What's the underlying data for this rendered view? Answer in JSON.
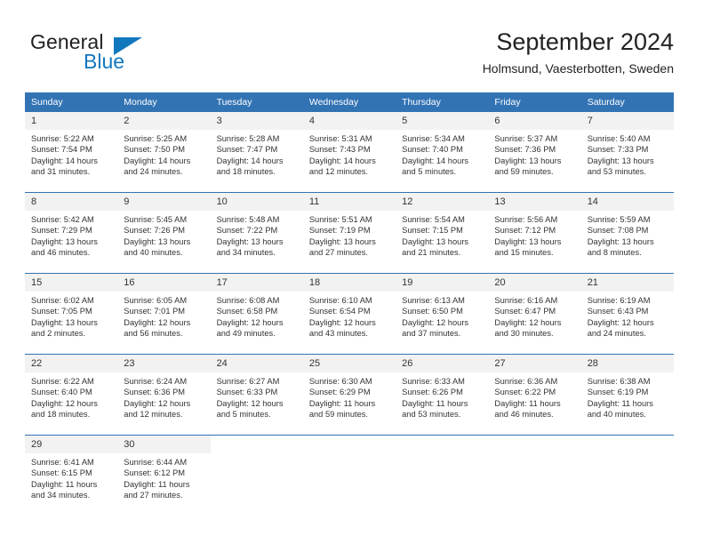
{
  "brand": {
    "name_part1": "General",
    "name_part2": "Blue",
    "accent_color": "#1278bd"
  },
  "header": {
    "title": "September 2024",
    "subtitle": "Holmsund, Vaesterbotten, Sweden"
  },
  "theme": {
    "header_blue": "#3273b4",
    "daynum_band": "#f2f2f2",
    "text": "#333333"
  },
  "calendar": {
    "weekday_headers": [
      "Sunday",
      "Monday",
      "Tuesday",
      "Wednesday",
      "Thursday",
      "Friday",
      "Saturday"
    ],
    "weeks": [
      [
        {
          "day": "1",
          "sunrise": "Sunrise: 5:22 AM",
          "sunset": "Sunset: 7:54 PM",
          "daylight_line1": "Daylight: 14 hours",
          "daylight_line2": "and 31 minutes."
        },
        {
          "day": "2",
          "sunrise": "Sunrise: 5:25 AM",
          "sunset": "Sunset: 7:50 PM",
          "daylight_line1": "Daylight: 14 hours",
          "daylight_line2": "and 24 minutes."
        },
        {
          "day": "3",
          "sunrise": "Sunrise: 5:28 AM",
          "sunset": "Sunset: 7:47 PM",
          "daylight_line1": "Daylight: 14 hours",
          "daylight_line2": "and 18 minutes."
        },
        {
          "day": "4",
          "sunrise": "Sunrise: 5:31 AM",
          "sunset": "Sunset: 7:43 PM",
          "daylight_line1": "Daylight: 14 hours",
          "daylight_line2": "and 12 minutes."
        },
        {
          "day": "5",
          "sunrise": "Sunrise: 5:34 AM",
          "sunset": "Sunset: 7:40 PM",
          "daylight_line1": "Daylight: 14 hours",
          "daylight_line2": "and 5 minutes."
        },
        {
          "day": "6",
          "sunrise": "Sunrise: 5:37 AM",
          "sunset": "Sunset: 7:36 PM",
          "daylight_line1": "Daylight: 13 hours",
          "daylight_line2": "and 59 minutes."
        },
        {
          "day": "7",
          "sunrise": "Sunrise: 5:40 AM",
          "sunset": "Sunset: 7:33 PM",
          "daylight_line1": "Daylight: 13 hours",
          "daylight_line2": "and 53 minutes."
        }
      ],
      [
        {
          "day": "8",
          "sunrise": "Sunrise: 5:42 AM",
          "sunset": "Sunset: 7:29 PM",
          "daylight_line1": "Daylight: 13 hours",
          "daylight_line2": "and 46 minutes."
        },
        {
          "day": "9",
          "sunrise": "Sunrise: 5:45 AM",
          "sunset": "Sunset: 7:26 PM",
          "daylight_line1": "Daylight: 13 hours",
          "daylight_line2": "and 40 minutes."
        },
        {
          "day": "10",
          "sunrise": "Sunrise: 5:48 AM",
          "sunset": "Sunset: 7:22 PM",
          "daylight_line1": "Daylight: 13 hours",
          "daylight_line2": "and 34 minutes."
        },
        {
          "day": "11",
          "sunrise": "Sunrise: 5:51 AM",
          "sunset": "Sunset: 7:19 PM",
          "daylight_line1": "Daylight: 13 hours",
          "daylight_line2": "and 27 minutes."
        },
        {
          "day": "12",
          "sunrise": "Sunrise: 5:54 AM",
          "sunset": "Sunset: 7:15 PM",
          "daylight_line1": "Daylight: 13 hours",
          "daylight_line2": "and 21 minutes."
        },
        {
          "day": "13",
          "sunrise": "Sunrise: 5:56 AM",
          "sunset": "Sunset: 7:12 PM",
          "daylight_line1": "Daylight: 13 hours",
          "daylight_line2": "and 15 minutes."
        },
        {
          "day": "14",
          "sunrise": "Sunrise: 5:59 AM",
          "sunset": "Sunset: 7:08 PM",
          "daylight_line1": "Daylight: 13 hours",
          "daylight_line2": "and 8 minutes."
        }
      ],
      [
        {
          "day": "15",
          "sunrise": "Sunrise: 6:02 AM",
          "sunset": "Sunset: 7:05 PM",
          "daylight_line1": "Daylight: 13 hours",
          "daylight_line2": "and 2 minutes."
        },
        {
          "day": "16",
          "sunrise": "Sunrise: 6:05 AM",
          "sunset": "Sunset: 7:01 PM",
          "daylight_line1": "Daylight: 12 hours",
          "daylight_line2": "and 56 minutes."
        },
        {
          "day": "17",
          "sunrise": "Sunrise: 6:08 AM",
          "sunset": "Sunset: 6:58 PM",
          "daylight_line1": "Daylight: 12 hours",
          "daylight_line2": "and 49 minutes."
        },
        {
          "day": "18",
          "sunrise": "Sunrise: 6:10 AM",
          "sunset": "Sunset: 6:54 PM",
          "daylight_line1": "Daylight: 12 hours",
          "daylight_line2": "and 43 minutes."
        },
        {
          "day": "19",
          "sunrise": "Sunrise: 6:13 AM",
          "sunset": "Sunset: 6:50 PM",
          "daylight_line1": "Daylight: 12 hours",
          "daylight_line2": "and 37 minutes."
        },
        {
          "day": "20",
          "sunrise": "Sunrise: 6:16 AM",
          "sunset": "Sunset: 6:47 PM",
          "daylight_line1": "Daylight: 12 hours",
          "daylight_line2": "and 30 minutes."
        },
        {
          "day": "21",
          "sunrise": "Sunrise: 6:19 AM",
          "sunset": "Sunset: 6:43 PM",
          "daylight_line1": "Daylight: 12 hours",
          "daylight_line2": "and 24 minutes."
        }
      ],
      [
        {
          "day": "22",
          "sunrise": "Sunrise: 6:22 AM",
          "sunset": "Sunset: 6:40 PM",
          "daylight_line1": "Daylight: 12 hours",
          "daylight_line2": "and 18 minutes."
        },
        {
          "day": "23",
          "sunrise": "Sunrise: 6:24 AM",
          "sunset": "Sunset: 6:36 PM",
          "daylight_line1": "Daylight: 12 hours",
          "daylight_line2": "and 12 minutes."
        },
        {
          "day": "24",
          "sunrise": "Sunrise: 6:27 AM",
          "sunset": "Sunset: 6:33 PM",
          "daylight_line1": "Daylight: 12 hours",
          "daylight_line2": "and 5 minutes."
        },
        {
          "day": "25",
          "sunrise": "Sunrise: 6:30 AM",
          "sunset": "Sunset: 6:29 PM",
          "daylight_line1": "Daylight: 11 hours",
          "daylight_line2": "and 59 minutes."
        },
        {
          "day": "26",
          "sunrise": "Sunrise: 6:33 AM",
          "sunset": "Sunset: 6:26 PM",
          "daylight_line1": "Daylight: 11 hours",
          "daylight_line2": "and 53 minutes."
        },
        {
          "day": "27",
          "sunrise": "Sunrise: 6:36 AM",
          "sunset": "Sunset: 6:22 PM",
          "daylight_line1": "Daylight: 11 hours",
          "daylight_line2": "and 46 minutes."
        },
        {
          "day": "28",
          "sunrise": "Sunrise: 6:38 AM",
          "sunset": "Sunset: 6:19 PM",
          "daylight_line1": "Daylight: 11 hours",
          "daylight_line2": "and 40 minutes."
        }
      ],
      [
        {
          "day": "29",
          "sunrise": "Sunrise: 6:41 AM",
          "sunset": "Sunset: 6:15 PM",
          "daylight_line1": "Daylight: 11 hours",
          "daylight_line2": "and 34 minutes."
        },
        {
          "day": "30",
          "sunrise": "Sunrise: 6:44 AM",
          "sunset": "Sunset: 6:12 PM",
          "daylight_line1": "Daylight: 11 hours",
          "daylight_line2": "and 27 minutes."
        },
        {
          "day": "",
          "sunrise": "",
          "sunset": "",
          "daylight_line1": "",
          "daylight_line2": ""
        },
        {
          "day": "",
          "sunrise": "",
          "sunset": "",
          "daylight_line1": "",
          "daylight_line2": ""
        },
        {
          "day": "",
          "sunrise": "",
          "sunset": "",
          "daylight_line1": "",
          "daylight_line2": ""
        },
        {
          "day": "",
          "sunrise": "",
          "sunset": "",
          "daylight_line1": "",
          "daylight_line2": ""
        },
        {
          "day": "",
          "sunrise": "",
          "sunset": "",
          "daylight_line1": "",
          "daylight_line2": ""
        }
      ]
    ]
  }
}
